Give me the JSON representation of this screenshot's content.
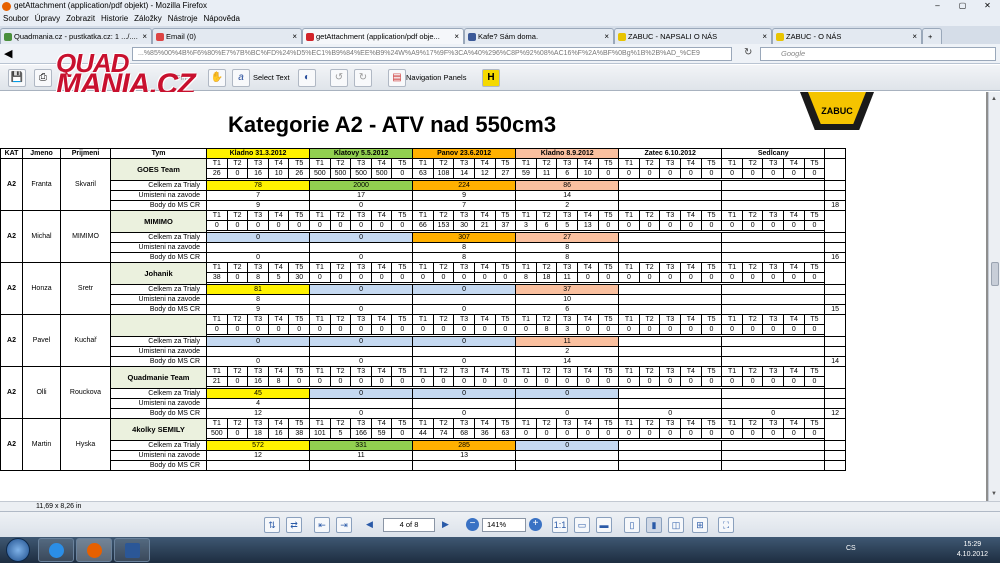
{
  "window": {
    "title": "getAttachment (application/pdf objekt) - Mozilla Firefox"
  },
  "menu": [
    "Soubor",
    "Úpravy",
    "Zobrazit",
    "Historie",
    "Záložky",
    "Nástroje",
    "Nápověda"
  ],
  "tabs": [
    {
      "label": "Quadmania.cz - pustkatka.cz: 1 .../....",
      "color": "#4a8f3c",
      "active": false
    },
    {
      "label": "Email (0)",
      "color": "#d44",
      "active": false
    },
    {
      "label": "getAttachment (application/pdf obje...",
      "color": "#d2232a",
      "active": true
    },
    {
      "label": "Kafe? Sám doma.",
      "color": "#3b5998",
      "active": false
    },
    {
      "label": "ZABUC - NAPSALI O NÁS",
      "color": "#e8c400",
      "active": false
    },
    {
      "label": "ZABUC - O NÁS",
      "color": "#e8c400",
      "active": false
    }
  ],
  "nav": {
    "url": "...%85%00%4B%F6%80%E7%7B%BC%FD%24%D5%EC1%B9%84%EE%B9%24W%A9%17%9F%3CA%40%296%C8P%92%08%AC16%F%2A%BF%0Bg%1B%2B%AD_%CE9",
    "search_placeholder": "Google"
  },
  "toolbar": {
    "find": "Find",
    "select_text": "Select Text",
    "navigation_panels": "Navigation Panels"
  },
  "logo": {
    "line1": "QUAD",
    "line2": "MANIA.CZ"
  },
  "doc": {
    "title": "Kategorie A2 - ATV nad 550cm3",
    "brand": "ZABUC"
  },
  "table": {
    "headers": {
      "kat": "KAT",
      "jmeno": "Jmeno",
      "prijmeni": "Prijmeni",
      "tym": "Tym"
    },
    "events": [
      {
        "name": "Kladno 31.3.2012",
        "cls": "y"
      },
      {
        "name": "Klatovy 5.5.2012",
        "cls": "g"
      },
      {
        "name": "Panov 23.6.2012",
        "cls": "o"
      },
      {
        "name": "Kladno 8.9.2012",
        "cls": "p"
      },
      {
        "name": "Zatec 6.10.2012",
        "cls": ""
      },
      {
        "name": "Sedlcany",
        "cls": ""
      }
    ],
    "trials": [
      "T1",
      "T2",
      "T3",
      "T4",
      "T5"
    ],
    "labels": {
      "celkem": "Celkem za Trialy",
      "umisteni": "Umisteni na zavode",
      "body": "Body do MS CR"
    },
    "riders": [
      {
        "kat": "A2",
        "jmeno": "Franta",
        "prijmeni": "Skvaril",
        "tym": "GOES Team",
        "total": "18",
        "scores": [
          [
            "26",
            "0",
            "16",
            "10",
            "26"
          ],
          [
            "500",
            "500",
            "500",
            "500",
            "0"
          ],
          [
            "63",
            "108",
            "14",
            "12",
            "27"
          ],
          [
            "59",
            "11",
            "6",
            "10",
            "0"
          ],
          [
            "0",
            "0",
            "0",
            "0",
            "0"
          ],
          [
            "0",
            "0",
            "0",
            "0",
            "0"
          ]
        ],
        "celkem": [
          "78",
          "2000",
          "224",
          "86",
          "",
          ""
        ],
        "umisteni": [
          "7",
          "17",
          "9",
          "14",
          "",
          ""
        ],
        "body": [
          "9",
          "0",
          "7",
          "2",
          "",
          ""
        ]
      },
      {
        "kat": "A2",
        "jmeno": "Michal",
        "prijmeni": "MIMIMO",
        "tym": "MIMIMO",
        "total": "16",
        "scores": [
          [
            "0",
            "0",
            "0",
            "0",
            "0"
          ],
          [
            "0",
            "0",
            "0",
            "0",
            "0"
          ],
          [
            "66",
            "153",
            "30",
            "21",
            "37"
          ],
          [
            "3",
            "6",
            "5",
            "13",
            "0"
          ],
          [
            "0",
            "0",
            "0",
            "0",
            "0"
          ],
          [
            "0",
            "0",
            "0",
            "0",
            "0"
          ]
        ],
        "celkem": [
          "0",
          "0",
          "307",
          "27",
          "",
          ""
        ],
        "umisteni": [
          "",
          "",
          "8",
          "8",
          "",
          ""
        ],
        "body": [
          "0",
          "0",
          "8",
          "8",
          "",
          ""
        ]
      },
      {
        "kat": "A2",
        "jmeno": "Honza",
        "prijmeni": "Sretr",
        "tym": "Johanik",
        "total": "15",
        "scores": [
          [
            "38",
            "0",
            "8",
            "5",
            "30"
          ],
          [
            "0",
            "0",
            "0",
            "0",
            "0"
          ],
          [
            "0",
            "0",
            "0",
            "0",
            "0"
          ],
          [
            "8",
            "18",
            "11",
            "0",
            "0"
          ],
          [
            "0",
            "0",
            "0",
            "0",
            "0"
          ],
          [
            "0",
            "0",
            "0",
            "0",
            "0"
          ]
        ],
        "celkem": [
          "81",
          "0",
          "0",
          "37",
          "",
          ""
        ],
        "umisteni": [
          "8",
          "",
          "",
          "10",
          "",
          ""
        ],
        "body": [
          "9",
          "0",
          "0",
          "6",
          "",
          ""
        ]
      },
      {
        "kat": "A2",
        "jmeno": "Pavel",
        "prijmeni": "Kuchař",
        "tym": "",
        "total": "14",
        "scores": [
          [
            "0",
            "0",
            "0",
            "0",
            "0"
          ],
          [
            "0",
            "0",
            "0",
            "0",
            "0"
          ],
          [
            "0",
            "0",
            "0",
            "0",
            "0"
          ],
          [
            "0",
            "8",
            "3",
            "0",
            "0"
          ],
          [
            "0",
            "0",
            "0",
            "0",
            "0"
          ],
          [
            "0",
            "0",
            "0",
            "0",
            "0"
          ]
        ],
        "celkem": [
          "0",
          "0",
          "0",
          "11",
          "",
          ""
        ],
        "umisteni": [
          "",
          "",
          "",
          "2",
          "",
          ""
        ],
        "body": [
          "0",
          "0",
          "0",
          "14",
          "",
          ""
        ]
      },
      {
        "kat": "A2",
        "jmeno": "Olli",
        "prijmeni": "Rouckova",
        "tym": "Quadmanie Team",
        "total": "12",
        "scores": [
          [
            "21",
            "0",
            "16",
            "8",
            "0"
          ],
          [
            "0",
            "0",
            "0",
            "0",
            "0"
          ],
          [
            "0",
            "0",
            "0",
            "0",
            "0"
          ],
          [
            "0",
            "0",
            "0",
            "0",
            "0"
          ],
          [
            "0",
            "0",
            "0",
            "0",
            "0"
          ],
          [
            "0",
            "0",
            "0",
            "0",
            "0"
          ]
        ],
        "celkem": [
          "45",
          "0",
          "0",
          "0",
          "",
          ""
        ],
        "umisteni": [
          "4",
          "",
          "",
          "",
          "",
          ""
        ],
        "body": [
          "12",
          "0",
          "0",
          "0",
          "0",
          "0"
        ]
      },
      {
        "kat": "A2",
        "jmeno": "Martin",
        "prijmeni": "Hyska",
        "tym": "4kolky SEMILY",
        "total": "",
        "scores": [
          [
            "500",
            "0",
            "18",
            "16",
            "38"
          ],
          [
            "101",
            "5",
            "166",
            "59",
            "0"
          ],
          [
            "44",
            "74",
            "68",
            "36",
            "63"
          ],
          [
            "0",
            "0",
            "0",
            "0",
            "0"
          ],
          [
            "0",
            "0",
            "0",
            "0",
            "0"
          ],
          [
            "0",
            "0",
            "0",
            "0",
            "0"
          ]
        ],
        "celkem": [
          "572",
          "331",
          "285",
          "0",
          "",
          ""
        ],
        "umisteni": [
          "12",
          "11",
          "13",
          "",
          "",
          ""
        ],
        "body": [
          "",
          "",
          "",
          "",
          "",
          ""
        ]
      }
    ]
  },
  "status": {
    "page_size": "11,69 x 8,26 in",
    "page": "4 of 8",
    "zoom": "141%"
  },
  "taskbar": {
    "lang": "CS",
    "time": "15:29",
    "date": "4.10.2012"
  }
}
